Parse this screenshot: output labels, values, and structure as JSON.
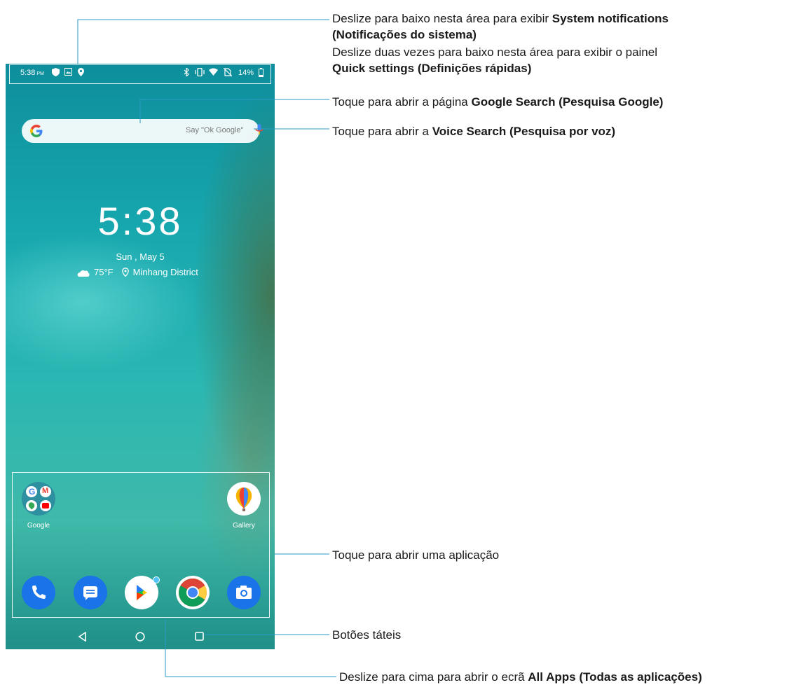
{
  "status_bar": {
    "time": "5:38",
    "ampm": "PM",
    "battery": "14%"
  },
  "search": {
    "placeholder": "Say \"Ok Google\""
  },
  "clock": {
    "time": "5:38",
    "date": "Sun , May 5",
    "temperature": "75°F",
    "location": "Minhang District"
  },
  "apps": {
    "google_folder": "Google",
    "gallery": "Gallery"
  },
  "dock": [
    "phone-icon",
    "messages-icon",
    "play-store-icon",
    "chrome-icon",
    "camera-icon"
  ],
  "annotations": {
    "system_notifications": {
      "pre": "Deslize para baixo nesta área para exibir ",
      "bold1": "System notifications",
      "bold2": "(Notificações do sistema)"
    },
    "quick_settings": {
      "pre": "Deslize duas vezes para baixo nesta área para exibir o painel",
      "bold": "Quick settings (Definições rápidas)"
    },
    "google_search": {
      "pre": "Toque para abrir a página ",
      "bold": "Google Search (Pesquisa Google)"
    },
    "voice_search": {
      "pre": "Toque para abrir a ",
      "bold": "Voice Search (Pesquisa por voz)"
    },
    "open_app": "Toque para abrir uma aplicação",
    "touch_buttons": "Botões táteis",
    "all_apps": {
      "pre": "Deslize para cima para abrir o ecrã ",
      "bold": "All Apps (Todas as aplicações)"
    }
  },
  "colors": {
    "accent_blue": "#1a73e8",
    "leader_line": "#2a9ac9"
  }
}
